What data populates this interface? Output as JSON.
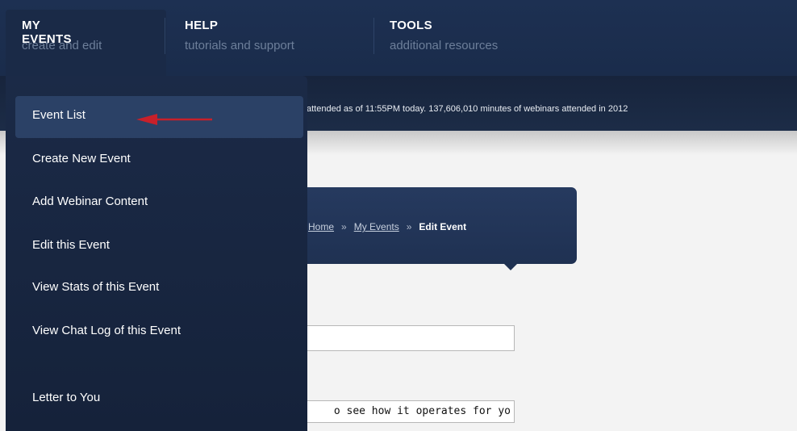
{
  "nav": {
    "items": [
      {
        "title": "MY EVENTS",
        "subtitle": "create and edit"
      },
      {
        "title": "HELP",
        "subtitle": "tutorials and support"
      },
      {
        "title": "TOOLS",
        "subtitle": "additional resources"
      }
    ]
  },
  "ticker": "attended as of 11:55PM today. 137,606,010 minutes of webinars attended in 2012",
  "breadcrumb": {
    "home": "Home",
    "sep": "»",
    "events": "My Events",
    "current": "Edit Event"
  },
  "dropdown": {
    "items": [
      "Event List",
      "Create New Event",
      "Add Webinar Content",
      "Edit this Event",
      "View Stats of this Event",
      "View Chat Log of this Event",
      "Letter to You"
    ]
  },
  "form": {
    "field2_value": "o see how it operates for yo"
  },
  "colors": {
    "arrow": "#c8202a",
    "nav_bg": "#1d3052"
  }
}
